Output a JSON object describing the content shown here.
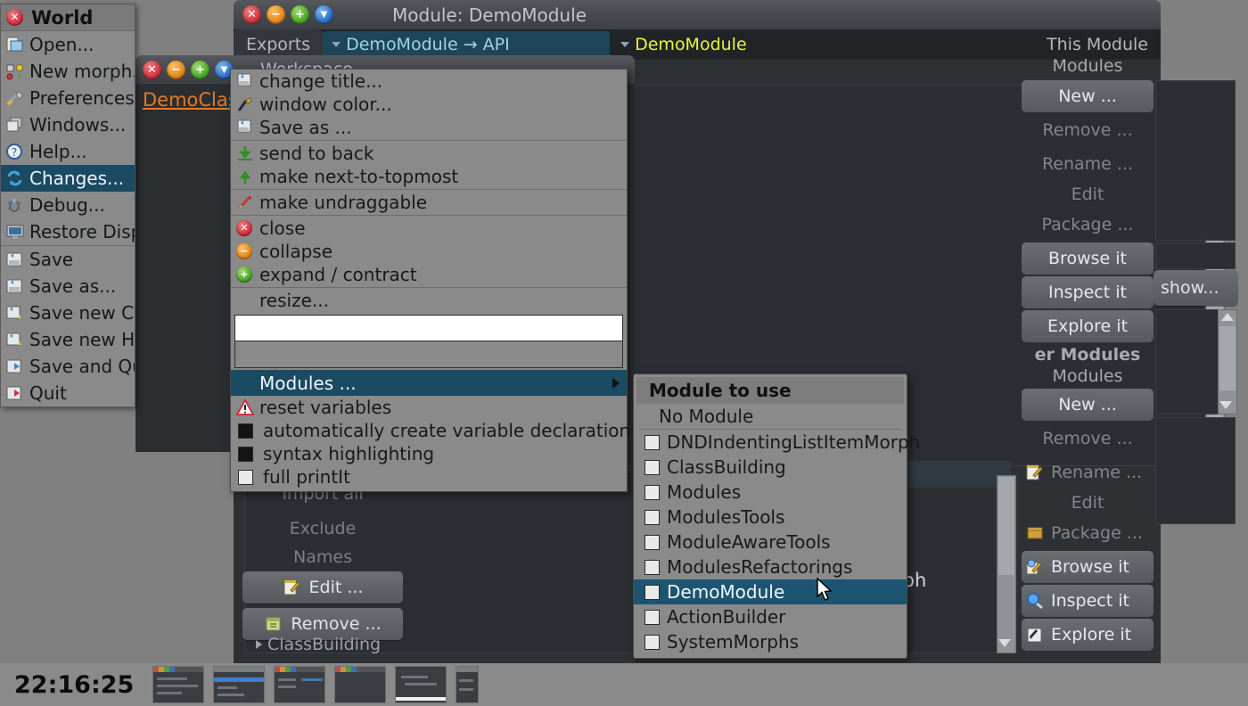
{
  "desktop": {
    "background_color": "#808080"
  },
  "module_window": {
    "title": "Module: DemoModule",
    "controls": [
      "close-button",
      "collapse-button",
      "expand-button",
      "menu-button"
    ],
    "tabs": [
      {
        "label": "Exports",
        "selected": false
      },
      {
        "label": "DemoModule → API",
        "selected": true,
        "kind": "dropdown"
      },
      {
        "label": "DemoModule",
        "selected": false,
        "kind": "dropdown"
      }
    ],
    "right_label": "This Module"
  },
  "workspace_window": {
    "title": "Workspace",
    "code_text": "DemoClas",
    "controls": [
      "close-button",
      "collapse-button",
      "expand-button",
      "menu-button"
    ]
  },
  "world_menu": {
    "title": "World",
    "items": [
      {
        "label": "Open...",
        "icon": "open-icon",
        "highlighted": false
      },
      {
        "label": "New morph...",
        "icon": "new-morph-icon",
        "highlighted": false
      },
      {
        "label": "Preferences...",
        "icon": "preferences-icon",
        "highlighted": false
      },
      {
        "label": "Windows...",
        "icon": "windows-icon",
        "highlighted": false
      },
      {
        "label": "Help...",
        "icon": "help-icon",
        "highlighted": false
      },
      {
        "label": "Changes...",
        "icon": "changes-icon",
        "highlighted": true
      },
      {
        "label": "Debug...",
        "icon": "debug-icon",
        "highlighted": false
      },
      {
        "label": "Restore Display",
        "icon": "display-icon",
        "highlighted": false
      },
      {
        "separator": true
      },
      {
        "label": "Save",
        "icon": "save-icon",
        "highlighted": false
      },
      {
        "label": "Save as...",
        "icon": "save-as-icon",
        "highlighted": false
      },
      {
        "label": "Save new Cu",
        "icon": "save-new-icon",
        "highlighted": false
      },
      {
        "label": "Save new Ha",
        "icon": "save-new-icon",
        "highlighted": false
      },
      {
        "label": "Save and Qu",
        "icon": "save-quit-icon",
        "highlighted": false
      },
      {
        "label": "Quit",
        "icon": "quit-icon",
        "highlighted": false
      }
    ]
  },
  "context_menu": {
    "items": [
      {
        "label": "change title...",
        "icon": "change-title-icon"
      },
      {
        "label": "window color...",
        "icon": "window-color-icon"
      },
      {
        "label": "Save as ...",
        "icon": "save-as-icon"
      },
      {
        "separator": true
      },
      {
        "label": "send to back",
        "icon": "send-to-back-icon"
      },
      {
        "label": "make next-to-topmost",
        "icon": "make-topmost-icon"
      },
      {
        "separator": true
      },
      {
        "label": "make undraggable",
        "icon": "undraggable-icon"
      },
      {
        "separator": true
      },
      {
        "label": "close",
        "icon": "close-icon"
      },
      {
        "label": "collapse",
        "icon": "collapse-icon"
      },
      {
        "label": "expand / contract",
        "icon": "expand-icon"
      },
      {
        "separator": true
      },
      {
        "label": "resize...",
        "icon": "none"
      }
    ],
    "text_field_value": "",
    "submenu_entry": {
      "label": "Modules ...",
      "highlighted": true
    },
    "toggles": [
      {
        "label": "reset variables",
        "icon": "warning-icon",
        "type": "action"
      },
      {
        "label": "automatically create variable declaration",
        "type": "checkbox",
        "checked": true
      },
      {
        "label": "syntax highlighting",
        "type": "checkbox",
        "checked": true
      },
      {
        "label": "full printIt",
        "type": "checkbox",
        "checked": false
      }
    ]
  },
  "module_submenu": {
    "title": "Module to use",
    "no_module_label": "No Module",
    "items": [
      {
        "label": "DNDIndentingListItemMorph",
        "checked": false,
        "highlighted": false
      },
      {
        "label": "ClassBuilding",
        "checked": false,
        "highlighted": false
      },
      {
        "label": "Modules",
        "checked": false,
        "highlighted": false
      },
      {
        "label": "ModulesTools",
        "checked": false,
        "highlighted": false
      },
      {
        "label": "ModuleAwareTools",
        "checked": false,
        "highlighted": false
      },
      {
        "label": "ModulesRefactorings",
        "checked": false,
        "highlighted": false
      },
      {
        "label": "DemoModule",
        "checked": false,
        "highlighted": true
      },
      {
        "label": "ActionBuilder",
        "checked": false,
        "highlighted": false
      },
      {
        "label": "SystemMorphs",
        "checked": false,
        "highlighted": false
      }
    ]
  },
  "module_tools": {
    "section1_header": "Modules",
    "section1_buttons": [
      {
        "label": "New ...",
        "enabled": true
      },
      {
        "label": "Remove ...",
        "enabled": false
      },
      {
        "label": "Rename ...",
        "enabled": false
      },
      {
        "label": "Edit",
        "enabled": false
      },
      {
        "label": "Package ...",
        "enabled": false
      },
      {
        "label": "Browse it",
        "enabled": true
      },
      {
        "label": "Inspect it",
        "enabled": true
      },
      {
        "label": "Explore it",
        "enabled": true
      }
    ],
    "section2_header_top": "er Modules",
    "section2_header": "Modules",
    "section2_buttons": [
      {
        "label": "New ...",
        "enabled": true
      },
      {
        "label": "Remove ...",
        "enabled": false
      },
      {
        "label": "Rename ...",
        "enabled": false,
        "icon": "rename-icon"
      },
      {
        "label": "Edit",
        "enabled": false
      },
      {
        "label": "Package ...",
        "enabled": false,
        "icon": "package-icon"
      },
      {
        "label": "Browse it",
        "enabled": true,
        "icon": "browse-icon"
      },
      {
        "label": "Inspect it",
        "enabled": true,
        "icon": "inspect-icon"
      },
      {
        "label": "Explore it",
        "enabled": true,
        "icon": "explore-icon"
      }
    ],
    "show_button": "show..."
  },
  "workspace_panel": {
    "buttons": [
      {
        "label": "Import all",
        "enabled": false
      },
      {
        "label": "Exclude",
        "enabled": false
      },
      {
        "label": "Names",
        "enabled": false,
        "type": "label"
      },
      {
        "label": "Edit ...",
        "enabled": true,
        "icon": "edit-icon"
      },
      {
        "label": "Remove ...",
        "enabled": true,
        "icon": "remove-icon"
      }
    ]
  },
  "background_tree": {
    "items": [
      {
        "label": "ClassBuilding"
      }
    ],
    "fragment_text": "rph"
  },
  "taskbar": {
    "clock": "22:16:25",
    "thumbnails": [
      "window-thumb-1",
      "window-thumb-2",
      "window-thumb-3",
      "window-thumb-4",
      "window-thumb-5",
      "window-thumb-6"
    ]
  }
}
